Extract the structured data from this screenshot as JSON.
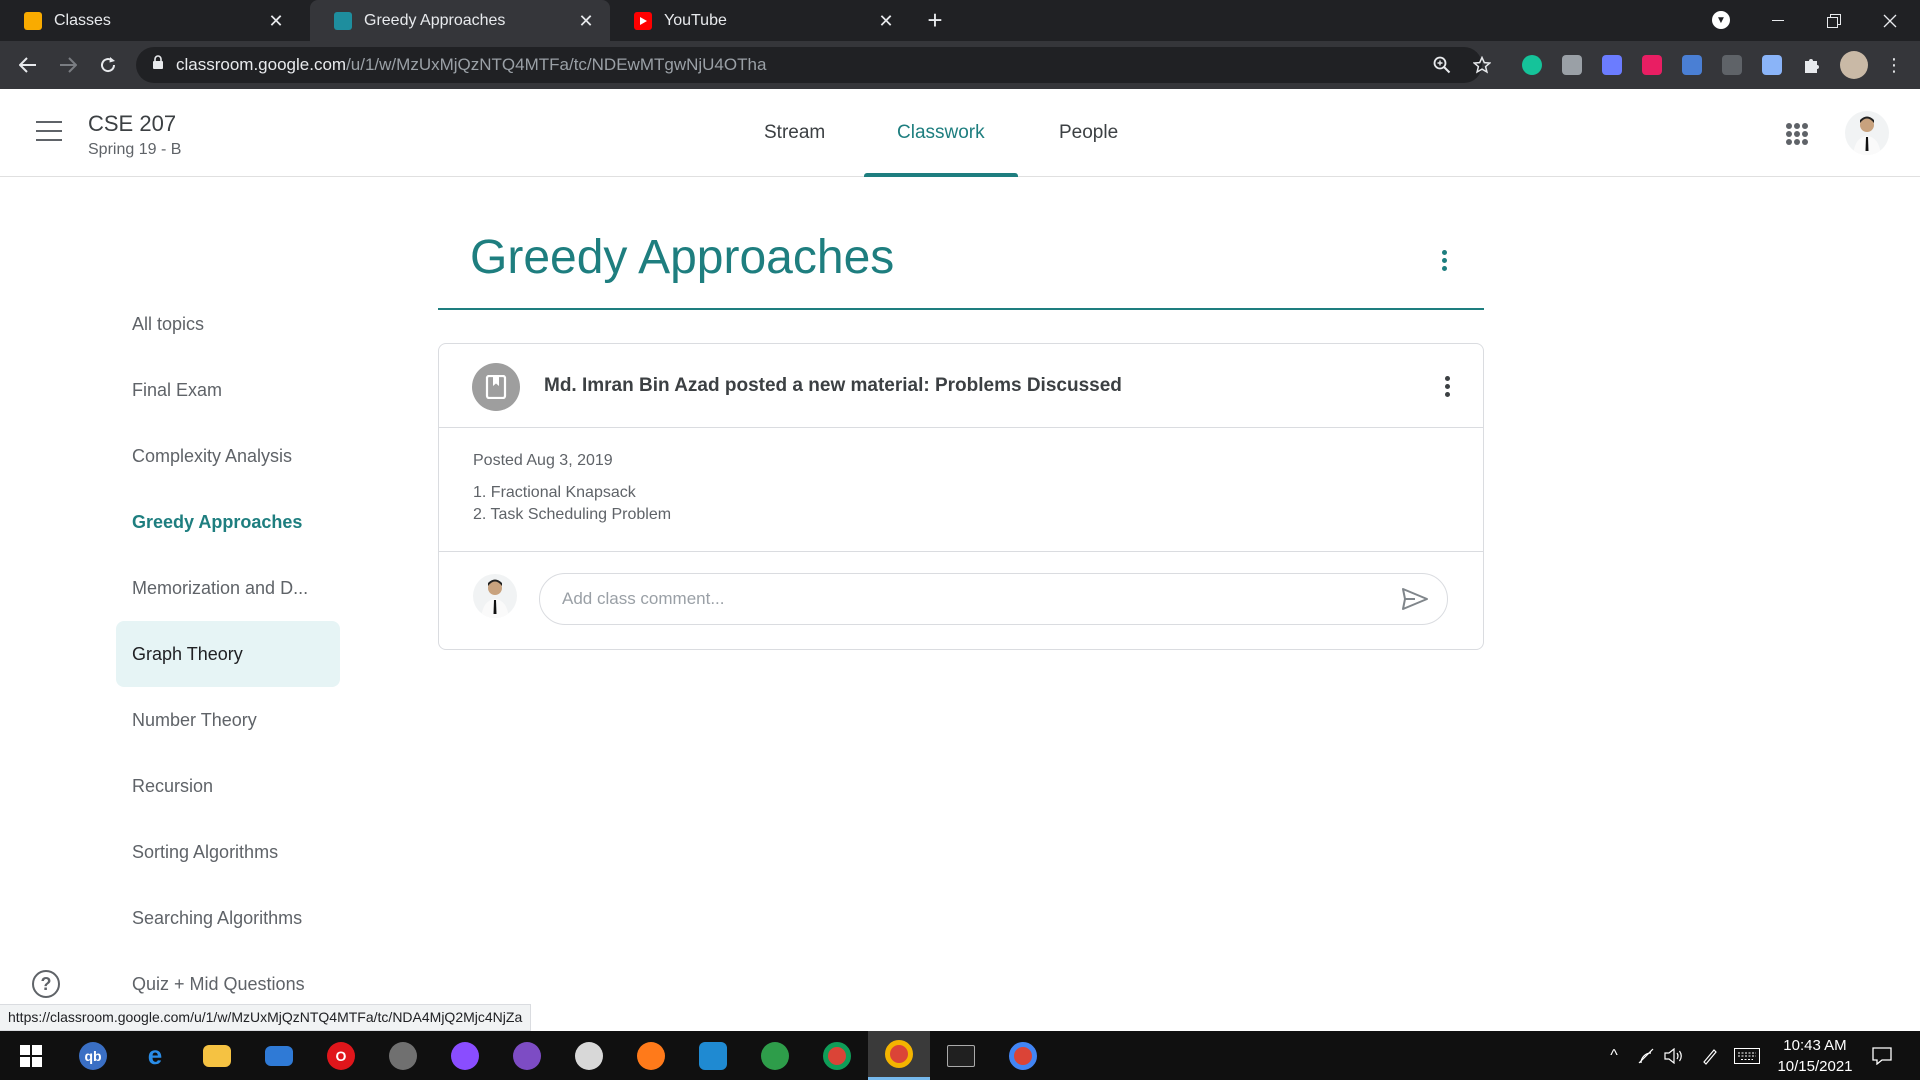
{
  "browser": {
    "tabs": [
      {
        "title": "Classes",
        "favicon": "classroom-yellow-icon",
        "color": "#f9ab00"
      },
      {
        "title": "Greedy Approaches",
        "favicon": "classroom-teal-icon",
        "color": "#1e8e9e"
      },
      {
        "title": "YouTube",
        "favicon": "youtube-icon",
        "color": "#ff0000"
      }
    ],
    "active_tab": 1,
    "url_host": "classroom.google.com",
    "url_path": "/u/1/w/MzUxMjQzNTQ4MTFa/tc/NDEwMTgwNjU4OTha",
    "status_link": "https://classroom.google.com/u/1/w/MzUxMjQzNTQ4MTFa/tc/NDA4MjQ2Mjc4NjZa"
  },
  "header": {
    "class_name": "CSE 207",
    "class_section": "Spring 19 - B",
    "tabs": [
      "Stream",
      "Classwork",
      "People"
    ],
    "active_tab": "Classwork"
  },
  "sidebar": {
    "topics": [
      "All topics",
      "Final Exam",
      "Complexity Analysis",
      "Greedy Approaches",
      "Memorization and D...",
      "Graph Theory",
      "Number Theory",
      "Recursion",
      "Sorting Algorithms",
      "Searching Algorithms",
      "Quiz + Mid Questions"
    ],
    "selected": "Greedy Approaches",
    "hovered": "Graph Theory"
  },
  "main": {
    "topic_title": "Greedy Approaches",
    "card": {
      "headline": "Md. Imran Bin Azad posted a new material: Problems Discussed",
      "posted": "Posted Aug 3, 2019",
      "description": [
        "1. Fractional Knapsack",
        "2. Task Scheduling Problem"
      ],
      "comment_placeholder": "Add class comment..."
    }
  },
  "taskbar": {
    "time": "10:43 AM",
    "date": "10/15/2021"
  },
  "colors": {
    "accent": "#1e7e7f",
    "hover_bg": "#e6f4f5"
  }
}
